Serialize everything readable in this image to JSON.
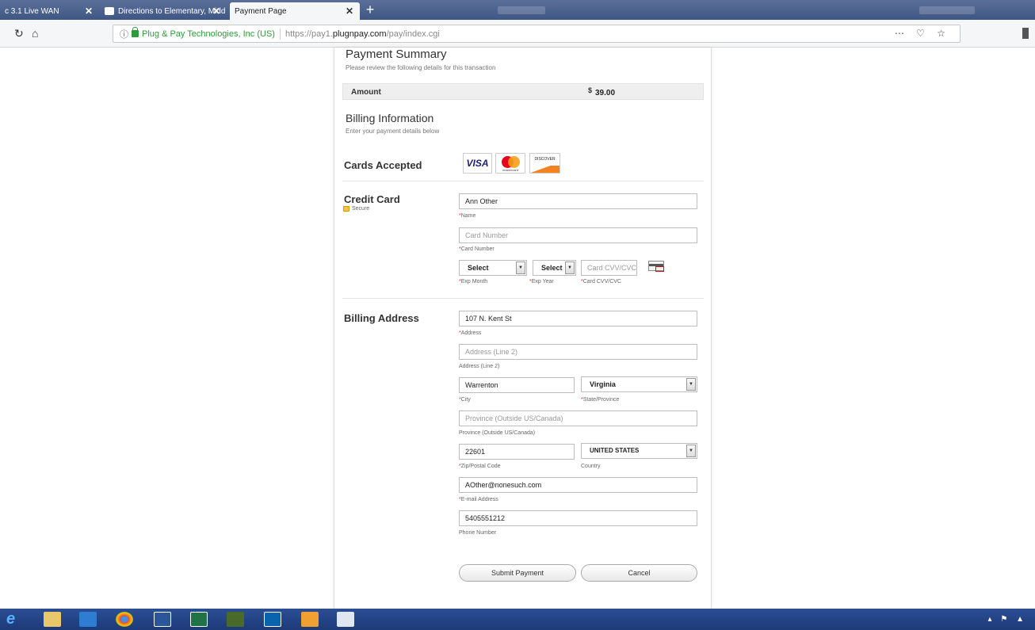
{
  "browser": {
    "tabs": [
      {
        "label": "c 3.1 Live WAN",
        "active": false
      },
      {
        "label": "Directions to Elementary, Midd",
        "active": false
      },
      {
        "label": "Payment Page",
        "active": true
      }
    ],
    "new_tab_symbol": "+",
    "close_symbol": "✕",
    "url": {
      "company": "Plug & Pay Technologies, Inc (US)",
      "prefix": "https://pay1.",
      "domain": "plugnpay.com",
      "path": "/pay/index.cgi"
    },
    "icons": [
      "reload-icon",
      "home-icon",
      "info-icon",
      "lock-icon",
      "more-icon",
      "pocket-icon",
      "bookmark-star-icon"
    ]
  },
  "payment_summary": {
    "title": "Payment Summary",
    "subtitle": "Please review the following details for this transaction",
    "amount_label": "Amount",
    "currency": "$",
    "amount": "39.00"
  },
  "billing_info": {
    "title": "Billing Information",
    "subtitle": "Enter your payment details below"
  },
  "cards_accepted": {
    "title": "Cards Accepted",
    "brands": [
      "VISA",
      "mastercard",
      "DISCOVER"
    ]
  },
  "credit_card": {
    "title": "Credit Card",
    "secure": "Secure",
    "name_value": "Ann Other",
    "name_label": "Name",
    "number_placeholder": "Card Number",
    "number_label": "Card Number",
    "exp_month_value": "Select",
    "exp_month_label": "Exp Month",
    "exp_year_value": "Select",
    "exp_year_label": "Exp Year",
    "cvv_placeholder": "Card CVV/CVC",
    "cvv_label": "Card CVV/CVC"
  },
  "billing_address": {
    "title": "Billing Address",
    "address_value": "107 N. Kent St",
    "address_label": "Address",
    "address2_placeholder": "Address (Line 2)",
    "address2_label": "Address (Line 2)",
    "city_value": "Warrenton",
    "city_label": "City",
    "state_value": "Virginia",
    "state_label": "State/Province",
    "province_placeholder": "Province (Outside US/Canada)",
    "province_label": "Province (Outside US/Canada)",
    "zip_value": "22601",
    "zip_label": "Zip/Postal Code",
    "country_value": "UNITED STATES",
    "country_label": "Country",
    "email_value": "AOther@nonesuch.com",
    "email_label": "E-mail Address",
    "phone_value": "5405551212",
    "phone_label": "Phone Number"
  },
  "actions": {
    "submit": "Submit Payment",
    "cancel": "Cancel"
  },
  "required_marker": "*",
  "colors": {
    "tabbar": "#3f5784",
    "taskbar": "#1d3a78",
    "secure_green": "#2e9b3a",
    "required_red": "#d33333"
  }
}
